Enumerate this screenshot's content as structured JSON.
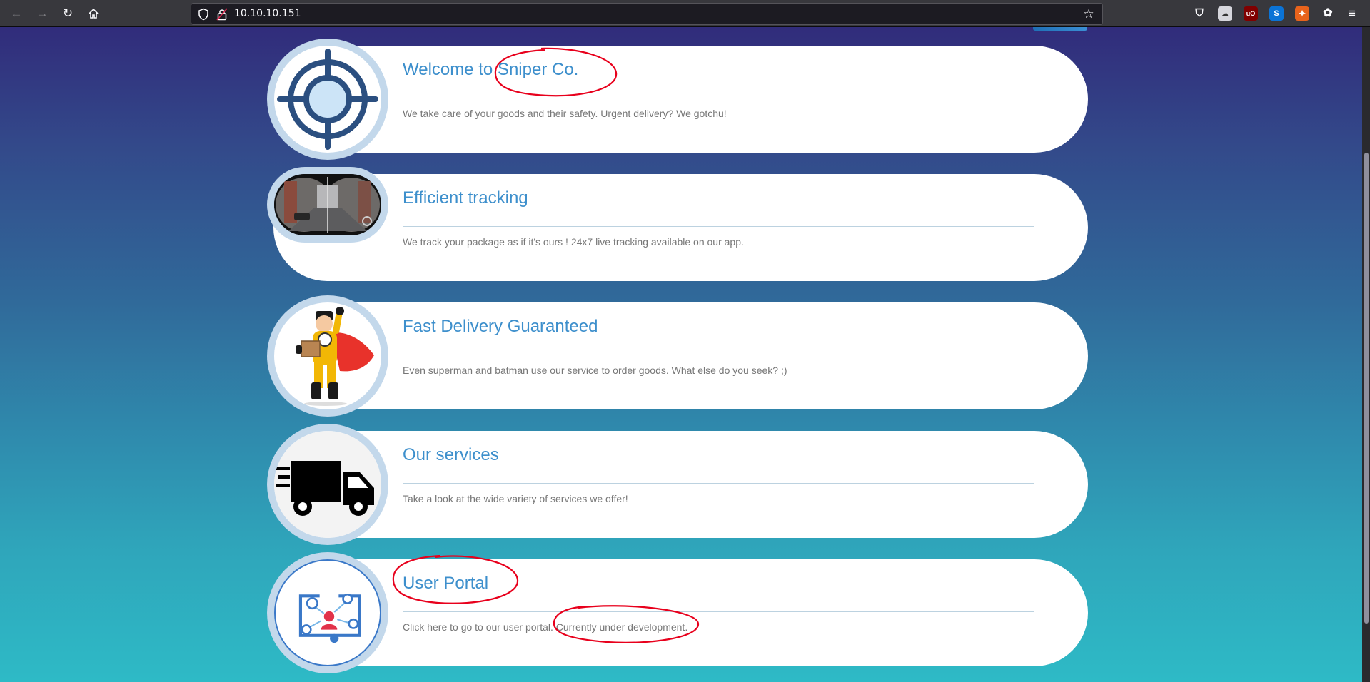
{
  "browser": {
    "url": "10.10.10.151",
    "nav_icons": {
      "back": "back-arrow-icon",
      "forward": "forward-arrow-icon",
      "reload": "reload-icon",
      "home": "home-icon"
    },
    "extensions": [
      "pocket-icon",
      "extension-icon",
      "ublock-icon",
      "s-extension-icon",
      "fox-extension-icon",
      "cookie-extension-icon",
      "menu-icon"
    ],
    "ublock_label": "uO",
    "s_label": "S"
  },
  "cards": [
    {
      "icon": "crosshair-icon",
      "title_prefix": "Welcome to ",
      "title_highlight": "Sniper Co.",
      "text": "We take care of your goods and their safety. Urgent delivery? We gotchu!"
    },
    {
      "icon": "binocular-view-icon",
      "title": "Efficient tracking",
      "text": "We track your package as if it's ours ! 24x7 live tracking available on our app."
    },
    {
      "icon": "superhero-delivery-icon",
      "title": "Fast Delivery Guaranteed",
      "text": "Even superman and batman use our service to order goods. What else do you seek? ;)"
    },
    {
      "icon": "delivery-truck-icon",
      "title": "Our services",
      "text": "Take a look at the wide variety of services we offer!"
    },
    {
      "icon": "user-network-icon",
      "title": "User Portal",
      "text_prefix": "Click here to go to our user portal. ",
      "text_highlight": "Currently under development."
    }
  ],
  "colors": {
    "accent": "#3d8fcc",
    "annotation": "#e8001c",
    "hero_cape": "#e8322b",
    "hero_suit": "#f2b705"
  }
}
